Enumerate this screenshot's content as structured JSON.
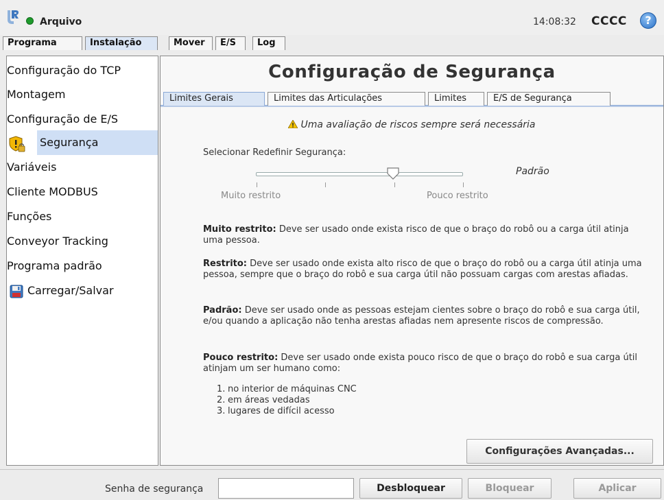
{
  "topbar": {
    "file_menu": "Arquivo",
    "time": "14:08:32",
    "robot_name": "CCCC",
    "help_label": "?"
  },
  "main_tabs": [
    {
      "label": "Programa"
    },
    {
      "label": "Instalação"
    },
    {
      "label": "Mover"
    },
    {
      "label": "E/S"
    },
    {
      "label": "Log"
    }
  ],
  "active_main_tab": "Instalação",
  "sidebar": {
    "items": [
      {
        "label": "Configuração do TCP"
      },
      {
        "label": "Montagem"
      },
      {
        "label": "Configuração de E/S"
      },
      {
        "label": "Segurança",
        "icon": "shield-warning-lock-icon"
      },
      {
        "label": "Variáveis"
      },
      {
        "label": "Cliente MODBUS"
      },
      {
        "label": "Funções"
      },
      {
        "label": "Conveyor Tracking"
      },
      {
        "label": "Programa padrão"
      },
      {
        "label": "Carregar/Salvar",
        "icon": "floppy-disk-icon"
      }
    ],
    "selected": "Segurança"
  },
  "content": {
    "title": "Configuração de Segurança",
    "tabs": [
      {
        "label": "Limites Gerais"
      },
      {
        "label": "Limites das Articulações"
      },
      {
        "label": "Limites"
      },
      {
        "label": "E/S de Segurança"
      }
    ],
    "active_tab": "Limites Gerais",
    "warning": "Uma avaliação de riscos sempre será necessária",
    "select_label": "Selecionar Redefinir Segurança:",
    "slider": {
      "value_label": "Padrão",
      "min_label": "Muito restrito",
      "max_label": "Pouco restrito",
      "position": 0.67
    },
    "descriptions": [
      {
        "term": "Muito restrito:",
        "text": "Deve ser usado onde exista risco de que o braço do robô ou a carga útil atinja uma pessoa."
      },
      {
        "term": "Restrito:",
        "text": "Deve ser usado onde exista alto risco de que o braço do robô ou a carga útil atinja uma pessoa, sempre que o braço do robô e sua carga útil não possuam cargas com arestas afiadas."
      },
      {
        "term": "Padrão:",
        "text": "Deve ser usado onde as pessoas estejam cientes sobre o braço do robô e sua carga útil, e/ou quando a aplicação não tenha arestas afiadas nem apresente riscos de compressão."
      },
      {
        "term": "Pouco restrito:",
        "text": "Deve ser usado onde exista pouco risco de que o braço do robô e sua carga útil atinjam um ser humano como:"
      }
    ],
    "places": [
      {
        "num": "1.",
        "text": "no interior de máquinas CNC"
      },
      {
        "num": "2.",
        "text": "em áreas vedadas"
      },
      {
        "num": "3.",
        "text": "lugares de difícil acesso"
      }
    ],
    "advanced_button": "Configurações Avançadas..."
  },
  "bottombar": {
    "password_label": "Senha de segurança",
    "password_value": "",
    "unlock_button": "Desbloquear",
    "lock_button": "Bloquear",
    "apply_button": "Aplicar"
  },
  "colors": {
    "accent": "#cfdff5",
    "status_ok": "#1e9a2c",
    "help": "#2b72c8"
  }
}
